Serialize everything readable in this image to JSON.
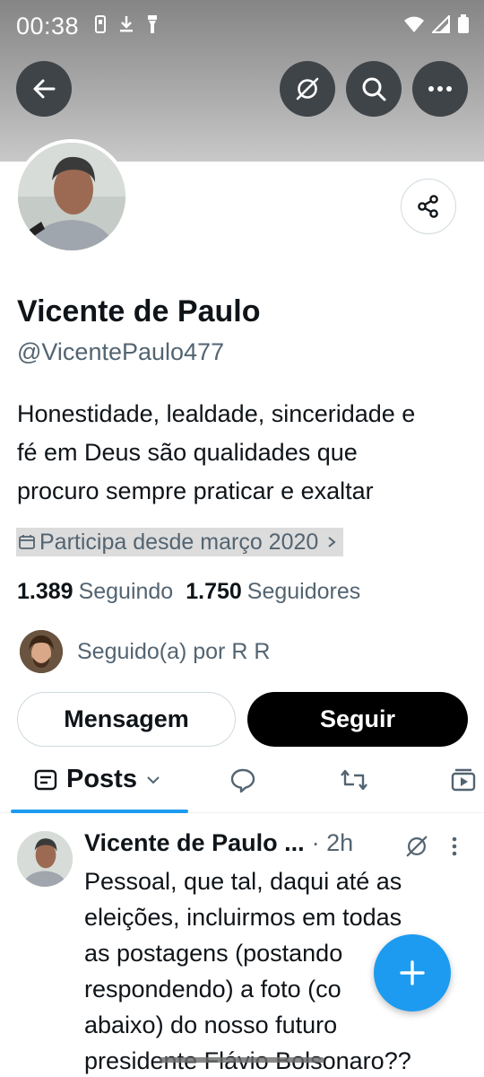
{
  "status_bar": {
    "time": "00:38"
  },
  "profile": {
    "name": "Vicente de Paulo",
    "handle": "@VicentePaulo477",
    "bio_lines": [
      "Honestidade, lealdade, sinceridade e",
      "fé em Deus são qualidades que",
      "procuro sempre praticar e exaltar"
    ],
    "joined": "Participa desde março 2020",
    "following_count": "1.389",
    "following_label": "Seguindo",
    "followers_count": "1.750",
    "followers_label": "Seguidores",
    "followed_by": "Seguido(a) por R R"
  },
  "actions": {
    "message_label": "Mensagem",
    "follow_label": "Seguir"
  },
  "tabs": {
    "posts_label": "Posts"
  },
  "post": {
    "author": "Vicente de Paulo ...",
    "time": "· 2h",
    "text_lines": [
      "Pessoal, que tal, daqui até as",
      "eleições, incluirmos em todas",
      "as  postagens (postando",
      "respondendo) a foto (co",
      "abaixo) do nosso futuro",
      "presidente Flávio Bolsonaro??"
    ]
  },
  "icons": [
    "back-arrow-icon",
    "grok-icon",
    "search-icon",
    "more-icon",
    "share-icon",
    "calendar-icon",
    "posts-tab-icon",
    "replies-icon",
    "reposts-icon",
    "media-icon",
    "compose-plus-icon"
  ],
  "colors": {
    "accent": "#1d9bf0",
    "text": "#0f1419",
    "secondary": "#536471"
  }
}
